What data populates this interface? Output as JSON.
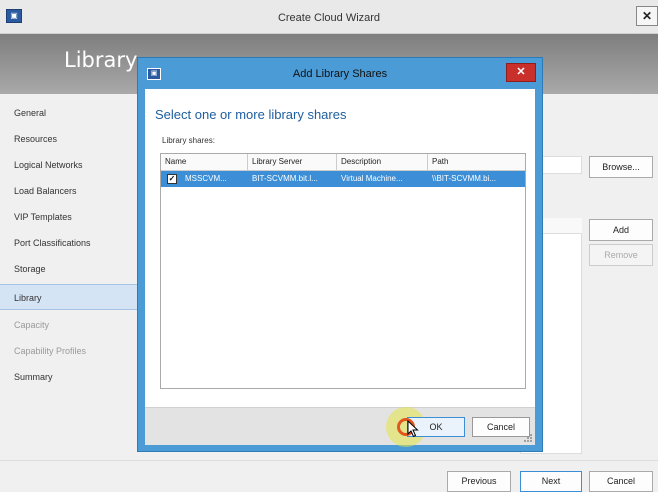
{
  "wizard": {
    "title": "Create Cloud Wizard",
    "header_title": "Library",
    "nav": [
      {
        "label": "General",
        "state": "normal"
      },
      {
        "label": "Resources",
        "state": "normal"
      },
      {
        "label": "Logical Networks",
        "state": "normal"
      },
      {
        "label": "Load Balancers",
        "state": "normal"
      },
      {
        "label": "VIP Templates",
        "state": "normal"
      },
      {
        "label": "Port Classifications",
        "state": "normal"
      },
      {
        "label": "Storage",
        "state": "normal"
      },
      {
        "label": "Library",
        "state": "selected"
      },
      {
        "label": "Capacity",
        "state": "disabled"
      },
      {
        "label": "Capability Profiles",
        "state": "disabled"
      },
      {
        "label": "Summary",
        "state": "normal"
      }
    ],
    "buttons": {
      "browse": "Browse...",
      "add": "Add",
      "remove": "Remove",
      "previous": "Previous",
      "next": "Next",
      "cancel": "Cancel"
    }
  },
  "dialog": {
    "title": "Add Library Shares",
    "heading": "Select one or more library shares",
    "subheading": "Library shares:",
    "columns": [
      "Name",
      "Library Server",
      "Description",
      "Path"
    ],
    "rows": [
      {
        "checked": true,
        "name": "MSSCVM...",
        "library_server": "BIT-SCVMM.bit.l...",
        "description": "Virtual Machine...",
        "path": "\\\\BIT-SCVMM.bi..."
      }
    ],
    "ok_label": "OK",
    "cancel_label": "Cancel"
  },
  "colors": {
    "dialog_border": "#4a9bd6",
    "selected_row": "#3c8ed6",
    "heading_text": "#1d5e9e",
    "close_button": "#c9302c"
  }
}
